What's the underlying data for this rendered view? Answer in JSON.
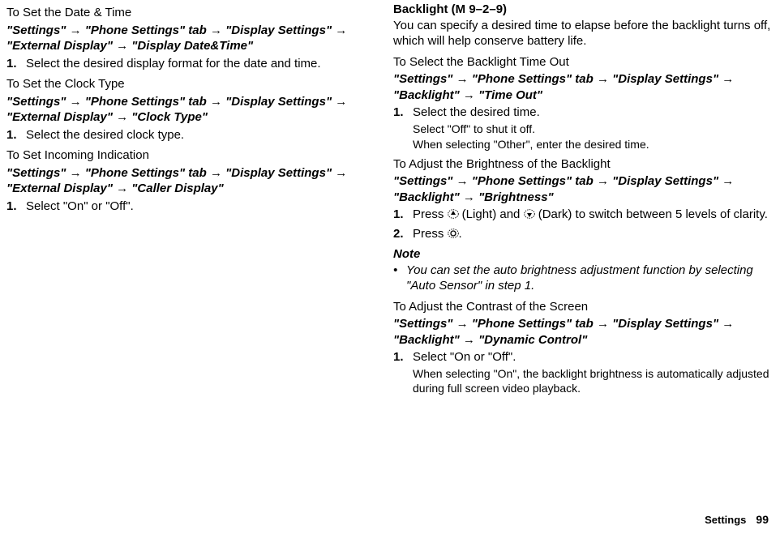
{
  "arrow": "→",
  "left": {
    "s1": {
      "title": "To Set the Date & Time",
      "path": "\"Settings\" → \"Phone Settings\" tab → \"Display Settings\" → \"External Display\" → \"Display Date&Time\"",
      "step1": "Select the desired display format for the date and time."
    },
    "s2": {
      "title": "To Set the Clock Type",
      "path": "\"Settings\" → \"Phone Settings\" tab → \"Display Settings\" → \"External Display\" → \"Clock Type\"",
      "step1": "Select the desired clock type."
    },
    "s3": {
      "title": "To Set Incoming Indication",
      "path": "\"Settings\" → \"Phone Settings\" tab → \"Display Settings\" → \"External Display\" → \"Caller Display\"",
      "step1": "Select \"On\" or \"Off\"."
    }
  },
  "right": {
    "h1": "Backlight",
    "h1_code": " (M 9–2–9)",
    "intro": "You can specify a desired time to elapse before the backlight turns off, which will help conserve battery life.",
    "s1": {
      "title": "To Select the Backlight Time Out",
      "path": "\"Settings\" → \"Phone Settings\" tab → \"Display Settings\" → \"Backlight\" → \"Time Out\"",
      "step1": "Select the desired time.",
      "step1a": "Select \"Off\" to shut it off.",
      "step1b": "When selecting \"Other\", enter the desired time."
    },
    "s2": {
      "title": "To Adjust the Brightness of the Backlight",
      "path": "\"Settings\" → \"Phone Settings\" tab → \"Display Settings\" → \"Backlight\" → \"Brightness\"",
      "step1a": "Press ",
      "step1b": " (Light) and ",
      "step1c": " (Dark) to switch between 5 levels of clarity.",
      "step2a": "Press ",
      "step2b": "."
    },
    "note_head": "Note",
    "note_body": "You can set the auto brightness adjustment function by selecting \"Auto Sensor\" in step 1.",
    "s3": {
      "title": "To Adjust the Contrast of the Screen",
      "path": "\"Settings\" → \"Phone Settings\" tab → \"Display Settings\" → \"Backlight\" → \"Dynamic Control\"",
      "step1": "Select \"On or \"Off\".",
      "step1a": "When selecting \"On\", the backlight brightness is automatically adjusted during full screen video playback."
    }
  },
  "footer": {
    "section": "Settings",
    "page": "99"
  }
}
